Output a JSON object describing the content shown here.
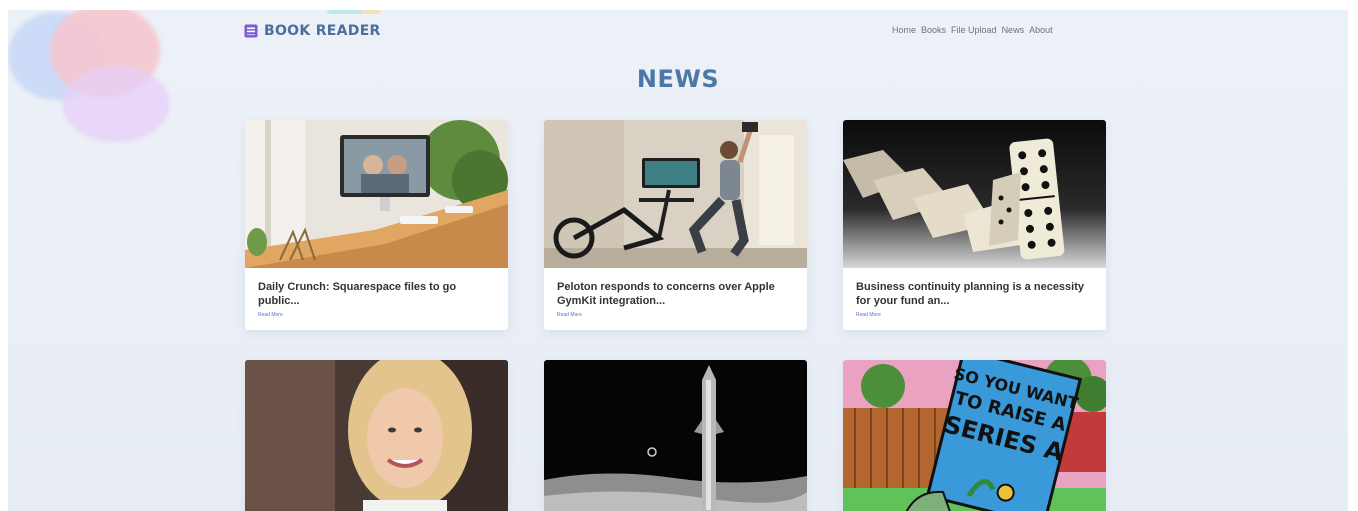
{
  "brand": {
    "name": "BOOK READER",
    "icon": "book-icon",
    "color": "#4c6f9f"
  },
  "nav": {
    "items": [
      {
        "label": "Home"
      },
      {
        "label": "Books"
      },
      {
        "label": "File Upload"
      },
      {
        "label": "News"
      },
      {
        "label": "About"
      }
    ]
  },
  "page": {
    "title": "NEWS",
    "title_color": "#4d77a8"
  },
  "articles": [
    {
      "title": "Daily Crunch: Squarespace files to go public...",
      "link": "Read More",
      "image": "desk-computer-photo"
    },
    {
      "title": "Peloton responds to concerns over Apple GymKit integration...",
      "link": "Read More",
      "image": "exercise-bike-photo"
    },
    {
      "title": "Business continuity planning is a necessity for your fund an...",
      "link": "Read More",
      "image": "dominoes-photo"
    },
    {
      "title": "",
      "link": "",
      "image": "woman-portrait-photo"
    },
    {
      "title": "",
      "link": "",
      "image": "rocket-moon-photo"
    },
    {
      "title": "",
      "link": "",
      "image": "series-a-book-illustration"
    }
  ],
  "colors": {
    "background": "#eaeef6",
    "link": "#5474c5"
  }
}
